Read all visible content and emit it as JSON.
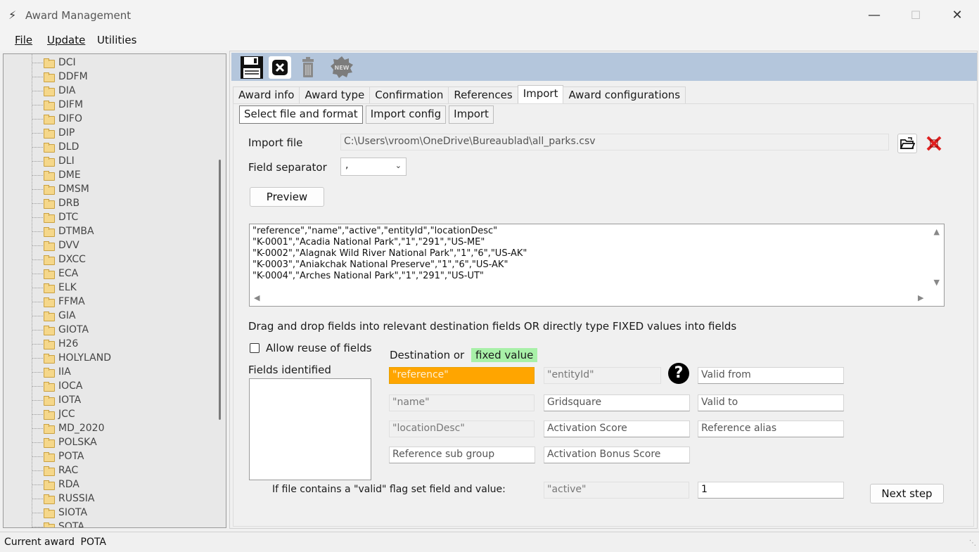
{
  "window": {
    "title": "Award Management"
  },
  "menu": {
    "file": "File",
    "update": "Update",
    "utilities": "Utilities"
  },
  "tree": {
    "items": [
      "DCI",
      "DDFM",
      "DIA",
      "DIFM",
      "DIFO",
      "DIP",
      "DLD",
      "DLI",
      "DME",
      "DMSM",
      "DRB",
      "DTC",
      "DTMBA",
      "DVV",
      "DXCC",
      "ECA",
      "ELK",
      "FFMA",
      "GIA",
      "GIOTA",
      "H26",
      "HOLYLAND",
      "IIA",
      "IOCA",
      "IOTA",
      "JCC",
      "MD_2020",
      "POLSKA",
      "POTA",
      "RAC",
      "RDA",
      "RUSSIA",
      "SIOTA",
      "SOTA"
    ]
  },
  "toolbar": {
    "new_icon_text": "NEW"
  },
  "tabs": [
    "Award info",
    "Award type",
    "Confirmation",
    "References",
    "Import",
    "Award configurations"
  ],
  "subtabs": [
    "Select file and format",
    "Import config",
    "Import"
  ],
  "form": {
    "import_file_label": "Import file",
    "import_file_value": "C:\\Users\\vroom\\OneDrive\\Bureaublad\\all_parks.csv",
    "field_separator_label": "Field separator",
    "field_separator_value": ",",
    "preview_button": "Preview",
    "preview_lines": [
      "\"reference\",\"name\",\"active\",\"entityId\",\"locationDesc\"",
      "\"K-0001\",\"Acadia National Park\",\"1\",\"291\",\"US-ME\"",
      "\"K-0002\",\"Alagnak Wild River National Park\",\"1\",\"6\",\"US-AK\"",
      "\"K-0003\",\"Aniakchak National Preserve\",\"1\",\"6\",\"US-AK\"",
      "\"K-0004\",\"Arches National Park\",\"1\",\"291\",\"US-UT\""
    ],
    "instruction": "Drag and drop fields into relevant destination fields OR directly type FIXED values into fields",
    "allow_reuse_label": "Allow reuse of fields",
    "fields_identified_label": "Fields identified",
    "destination_label": "Destination or",
    "fixed_value_label": "fixed value",
    "help_glyph": "?",
    "dest": {
      "reference": "\"reference\"",
      "entity_id": "\"entityId\"",
      "valid_from": "Valid from",
      "name": "\"name\"",
      "gridsquare": "Gridsquare",
      "valid_to": "Valid to",
      "location_desc": "\"locationDesc\"",
      "activation_score": "Activation Score",
      "reference_alias": "Reference alias",
      "reference_sub_group": "Reference sub group",
      "activation_bonus_score": "Activation Bonus Score"
    },
    "valid_flag_label": "If file contains a \"valid\" flag set field and value:",
    "valid_flag_field": "\"active\"",
    "valid_flag_value": "1",
    "next_step_button": "Next step"
  },
  "status": {
    "label": "Current award",
    "value": "POTA"
  },
  "colors": {
    "toolbar_bg": "#b4c6dc",
    "highlight": "#ffa500",
    "fixed_badge": "#a8f0a8",
    "delete_red": "#e02020"
  }
}
